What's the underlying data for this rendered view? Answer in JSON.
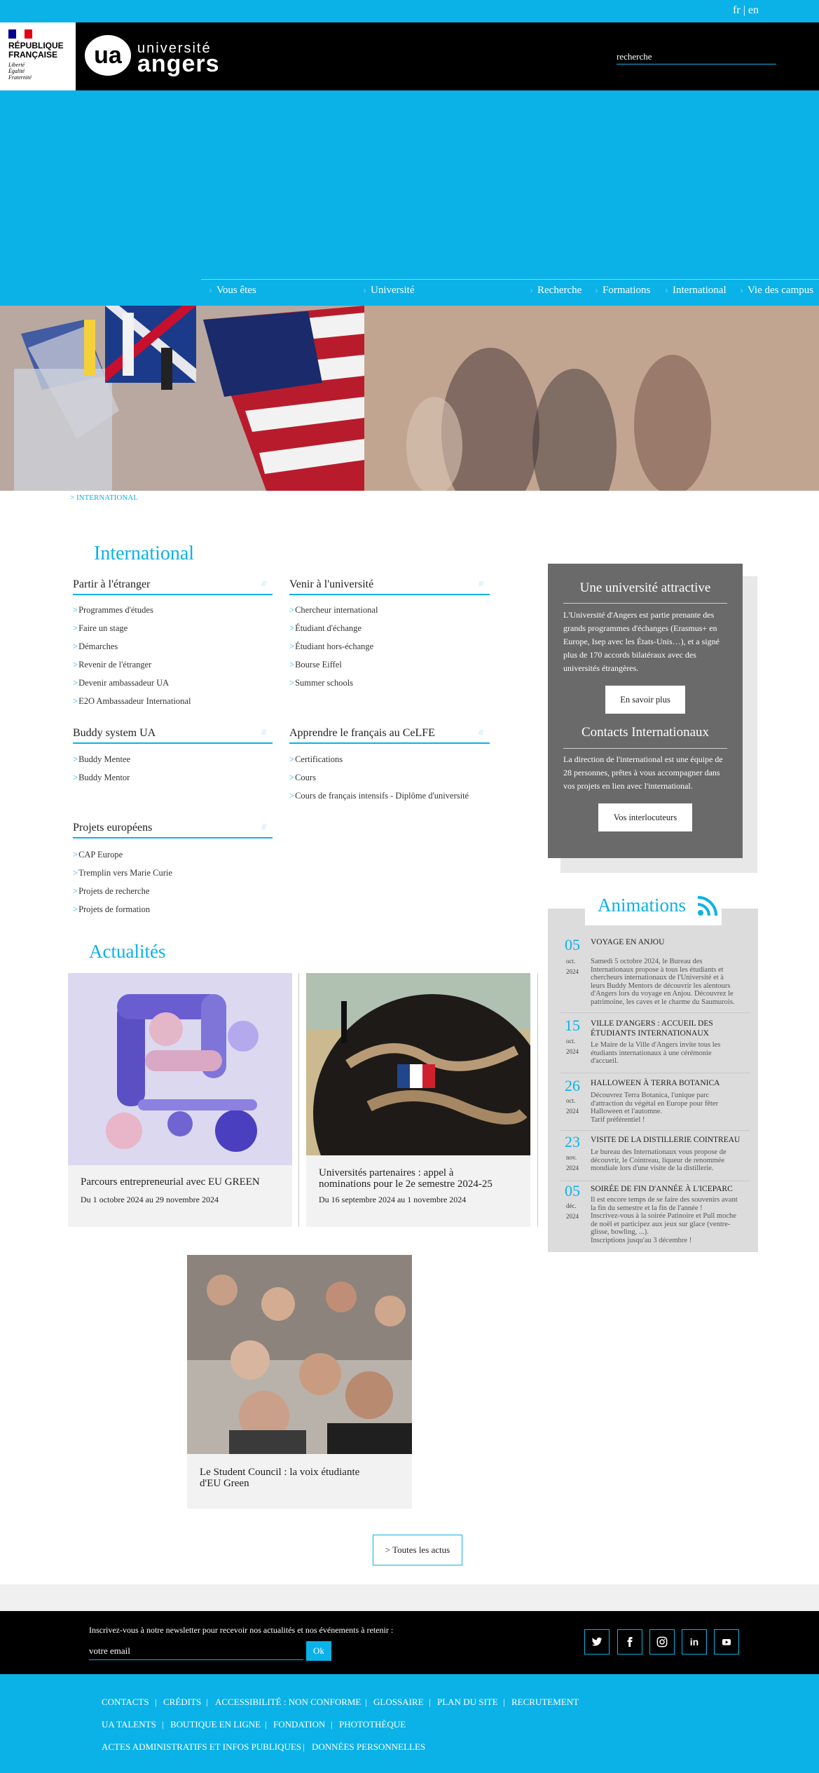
{
  "lang": {
    "fr": "fr",
    "sep": "|",
    "en": "en"
  },
  "republique": {
    "line1": "RÉPUBLIQUE",
    "line2": "FRANÇAISE",
    "motto1": "Liberté",
    "motto2": "Égalité",
    "motto3": "Fraternité"
  },
  "logo": {
    "mark": "ua",
    "top": "université",
    "bottom": "angers"
  },
  "search": {
    "placeholder": "recherche"
  },
  "nav": [
    "Vous êtes",
    "Université",
    "Recherche",
    "Formations",
    "International",
    "Vie des campus"
  ],
  "breadcrumb": "> INTERNATIONAL",
  "page_title": "International",
  "sections": {
    "partir": {
      "title": "Partir à l'étranger",
      "links": [
        "Programmes d'études",
        "Faire un stage",
        "Démarches",
        "Revenir de l'étranger",
        "Devenir ambassadeur UA",
        "E2O Ambassadeur International"
      ]
    },
    "venir": {
      "title": "Venir à l'université",
      "links": [
        "Chercheur international",
        "Étudiant d'échange",
        "Étudiant hors-échange",
        "Bourse Eiffel",
        "Summer schools"
      ]
    },
    "buddy": {
      "title": "Buddy system UA",
      "links": [
        "Buddy Mentee",
        "Buddy Mentor"
      ]
    },
    "celfe": {
      "title": "Apprendre le français au CeLFE",
      "links": [
        "Certifications",
        "Cours",
        "Cours de français intensifs - Diplôme d'université"
      ]
    },
    "projets": {
      "title": "Projets européens",
      "links": [
        "CAP Europe",
        "Tremplin vers Marie Curie",
        "Projets de recherche",
        "Projets de formation"
      ]
    }
  },
  "panel": {
    "h1": "Une université attractive",
    "p1": "L'Université d'Angers est partie prenante des grands programmes d'échanges (Erasmus+ en Europe, Isep avec les États-Unis…), et a signé plus de 170 accords bilatéraux avec des universités étrangères.",
    "btn1": "En savoir plus",
    "h2": "Contacts Internationaux",
    "p2": "La direction de l'international est une équipe de 28 personnes, prêtes à vous accompagner dans vos projets en lien avec l'international.",
    "btn2": "Vos interlocuteurs"
  },
  "animations": {
    "title": "Animations",
    "events": [
      {
        "day": "05",
        "mon": "oct.",
        "year": "2024",
        "title": "VOYAGE EN ANJOU",
        "desc": [
          "Samedi 5 octobre 2024, le Bureau des",
          "Internationaux propose à tous les étudiants et",
          "chercheurs internationaux de l'Université et à",
          "leurs Buddy Mentors de découvrir les alentours",
          "d'Angers lors du voyage en Anjou. Découvrez le",
          "patrimoine, les caves et le charme du Saumurois."
        ]
      },
      {
        "day": "15",
        "mon": "oct.",
        "year": "2024",
        "title": "VILLE D'ANGERS : ACCUEIL DES ÉTUDIANTS INTERNATIONAUX",
        "desc": [
          "Le Maire de la Ville d'Angers invite tous les",
          "étudiants internationaux à une cérémonie",
          "d'accueil."
        ]
      },
      {
        "day": "26",
        "mon": "oct.",
        "year": "2024",
        "title": "HALLOWEEN À TERRA BOTANICA",
        "desc": [
          "Découvrez Terra Botanica, l'unique parc",
          "d'attraction du végétal en Europe pour fêter",
          "Halloween et l'automne.",
          "Tarif préférentiel !"
        ]
      },
      {
        "day": "23",
        "mon": "nov.",
        "year": "2024",
        "title": "VISITE DE LA DISTILLERIE COINTREAU",
        "desc": [
          "Le bureau des Internationaux vous propose de",
          "découvrir, le Cointreau, liqueur de renommée",
          "mondiale lors d'une visite de la distillerie."
        ]
      },
      {
        "day": "05",
        "mon": "déc.",
        "year": "2024",
        "title": "SOIRÉE DE FIN D'ANNÉE À L'ICEPARC",
        "desc": [
          "Il est encore temps de se faire des souvenirs avant",
          "la fin du semestre et la fin de l'année !",
          "Inscrivez-vous à la soirée Patinoire et Pull moche",
          "de noël et participez aux jeux sur glace (ventre-",
          "glisse, bowling, ...).",
          "Inscriptions jusqu'au 3 décembre !"
        ]
      }
    ]
  },
  "news": {
    "title": "Actualités",
    "items": [
      {
        "title": "Parcours entrepreneurial avec EU GREEN",
        "date": "Du 1 octobre 2024 au 29 novembre 2024"
      },
      {
        "title1": "Universités partenaires : appel à",
        "title2": "nominations pour le 2e semestre 2024-25",
        "date": "Du 16 septembre 2024 au 1 novembre 2024"
      },
      {
        "title1": "Le Student Council : la voix étudiante",
        "title2": "d'EU Green"
      }
    ],
    "all": "> Toutes les actus"
  },
  "newsletter": {
    "label": "Inscrivez-vous à notre newsletter pour recevoir nos actualités et nos événements à retenir :",
    "placeholder": "votre email",
    "button": "Ok"
  },
  "social": [
    "twitter-icon",
    "facebook-icon",
    "instagram-icon",
    "linkedin-icon",
    "youtube-icon"
  ],
  "footer": {
    "row1": [
      "CONTACTS",
      "CRÉDITS",
      "ACCESSIBILITÉ : NON CONFORME",
      "GLOSSAIRE",
      "PLAN DU SITE",
      "RECRUTEMENT"
    ],
    "row2": [
      "UA TALENTS",
      "BOUTIQUE EN LIGNE",
      "FONDATION",
      "PHOTOTHÈQUE"
    ],
    "row3": [
      "ACTES ADMINISTRATIFS ET INFOS PUBLIQUES",
      "DONNÉES PERSONNELLES"
    ]
  },
  "colors": {
    "accent": "#0ab2e8",
    "panel": "#6a6a6a",
    "black": "#000000"
  }
}
